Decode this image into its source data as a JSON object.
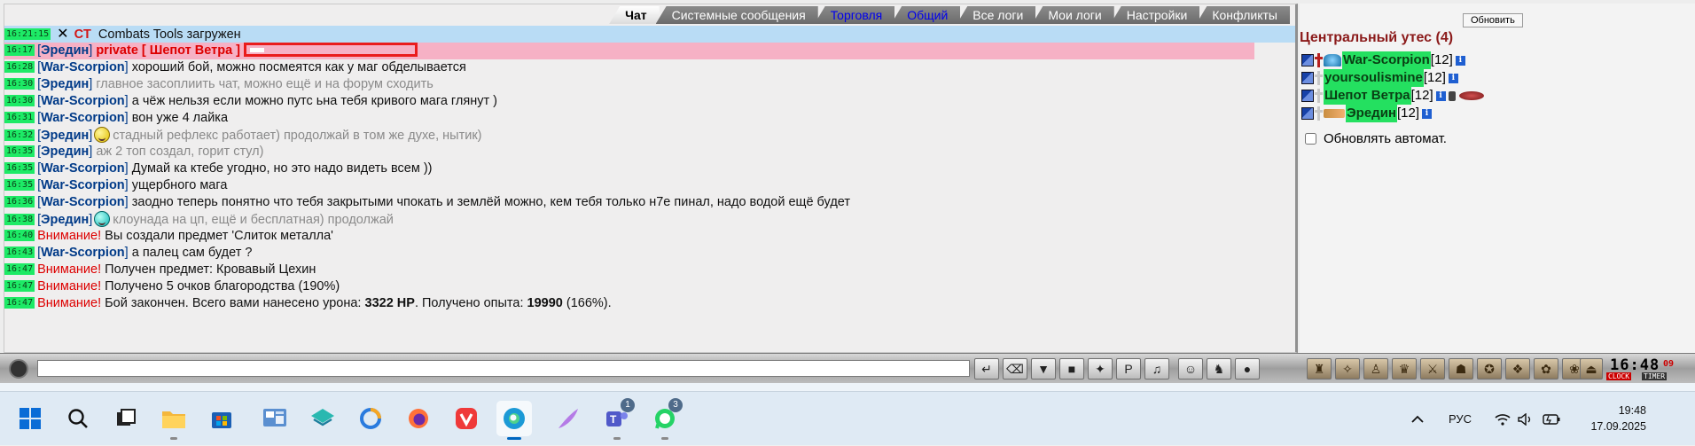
{
  "tabs": [
    {
      "label": "Чат",
      "active": true,
      "link": false
    },
    {
      "label": "Системные сообщения",
      "active": false,
      "link": false
    },
    {
      "label": "Торговля",
      "active": false,
      "link": true
    },
    {
      "label": "Общий",
      "active": false,
      "link": true
    },
    {
      "label": "Все логи",
      "active": false,
      "link": false
    },
    {
      "label": "Мои логи",
      "active": false,
      "link": false
    },
    {
      "label": "Настройки",
      "active": false,
      "link": false
    },
    {
      "label": "Конфликты",
      "active": false,
      "link": false
    }
  ],
  "system_row": {
    "time": "16:21:15",
    "ct": "CT",
    "text": "Combats Tools загружен"
  },
  "private_row": {
    "time": "16:17",
    "nick": "Эредин",
    "label": "private [ Шепот Ветра ]"
  },
  "messages": [
    {
      "time": "16:28",
      "nick": "War-Scorpion",
      "text": "хороший бой, можно посмеятся как у маг обделывается",
      "gray": false,
      "smile": ""
    },
    {
      "time": "16:30",
      "nick": "Эредин",
      "text": "главное засоплиить чат, можно ещё и на форум сходить",
      "gray": true,
      "smile": ""
    },
    {
      "time": "16:30",
      "nick": "War-Scorpion",
      "text": "а чёж нельзя если можно путс ьна тебя кривого мага глянут )",
      "gray": false,
      "smile": ""
    },
    {
      "time": "16:31",
      "nick": "War-Scorpion",
      "text": "вон уже 4 лайка",
      "gray": false,
      "smile": ""
    },
    {
      "time": "16:32",
      "nick": "Эредин",
      "text": "стадный рефлекс работает) продолжай в том же духе, нытик)",
      "gray": true,
      "smile": "yellow"
    },
    {
      "time": "16:35",
      "nick": "Эредин",
      "text": "аж 2 топ создал, горит стул)",
      "gray": true,
      "smile": ""
    },
    {
      "time": "16:35",
      "nick": "War-Scorpion",
      "text": "Думай ка ктебе угодно, но это надо видеть всем ))",
      "gray": false,
      "smile": ""
    },
    {
      "time": "16:35",
      "nick": "War-Scorpion",
      "text": "ущербного мага",
      "gray": false,
      "smile": ""
    },
    {
      "time": "16:36",
      "nick": "War-Scorpion",
      "text": "заодно теперь понятно что тебя закрытыми чпокать и землёй можно, кем тебя только н7е пинал, надо водой ещё будет",
      "gray": false,
      "smile": ""
    },
    {
      "time": "16:38",
      "nick": "Эредин",
      "text": "клоунада на цп, ещё и бесплатная) продолжай",
      "gray": true,
      "smile": "teal"
    }
  ],
  "system_messages": [
    {
      "time": "16:40",
      "label": "Внимание!",
      "text": "Вы создали предмет 'Слиток металла'"
    },
    {
      "time": "16:43",
      "nick": "War-Scorpion",
      "text": "а палец сам будет ?"
    },
    {
      "time": "16:47",
      "label": "Внимание!",
      "text": "Получен предмет: Кровавый Цехин"
    },
    {
      "time": "16:47",
      "label": "Внимание!",
      "text": "Получено 5 очков благородства (190%)"
    }
  ],
  "final_message": {
    "time": "16:47",
    "label": "Внимание!",
    "part1": "Бой закончен. Всего вами нанесено урона: ",
    "damage": "3322 HP",
    "part2": ". Получено опыта: ",
    "exp": "19990",
    "part3": " (166%)."
  },
  "right_panel": {
    "refresh_label": "Обновить",
    "location": "Центральный утес (4)",
    "users": [
      {
        "name": "War-Scorpion",
        "level": "[12]",
        "extra": ""
      },
      {
        "name": "yoursoulismine",
        "level": "[12]",
        "extra": ""
      },
      {
        "name": "Шепот Ветра",
        "level": "[12]",
        "extra": "injury"
      },
      {
        "name": "Эредин",
        "level": "[12]",
        "extra": ""
      }
    ],
    "auto_refresh_label": "Обновлять автомат."
  },
  "clock": {
    "time": "16:48",
    "seconds": "09",
    "clock_label": "CLOCK",
    "timer_label": "TIMER"
  },
  "taskbar": {
    "lang": "РУС",
    "time": "19:48",
    "date": "17.09.2025",
    "teams_badge": "1",
    "whatsapp_badge": "3"
  },
  "colors": {
    "timestamp_bg": "#1dea66",
    "nick": "#003a88",
    "alert": "#dd0000",
    "private_bg": "#f6b1c5",
    "system_bg": "#b9dcf5",
    "location": "#8b1a1a"
  }
}
